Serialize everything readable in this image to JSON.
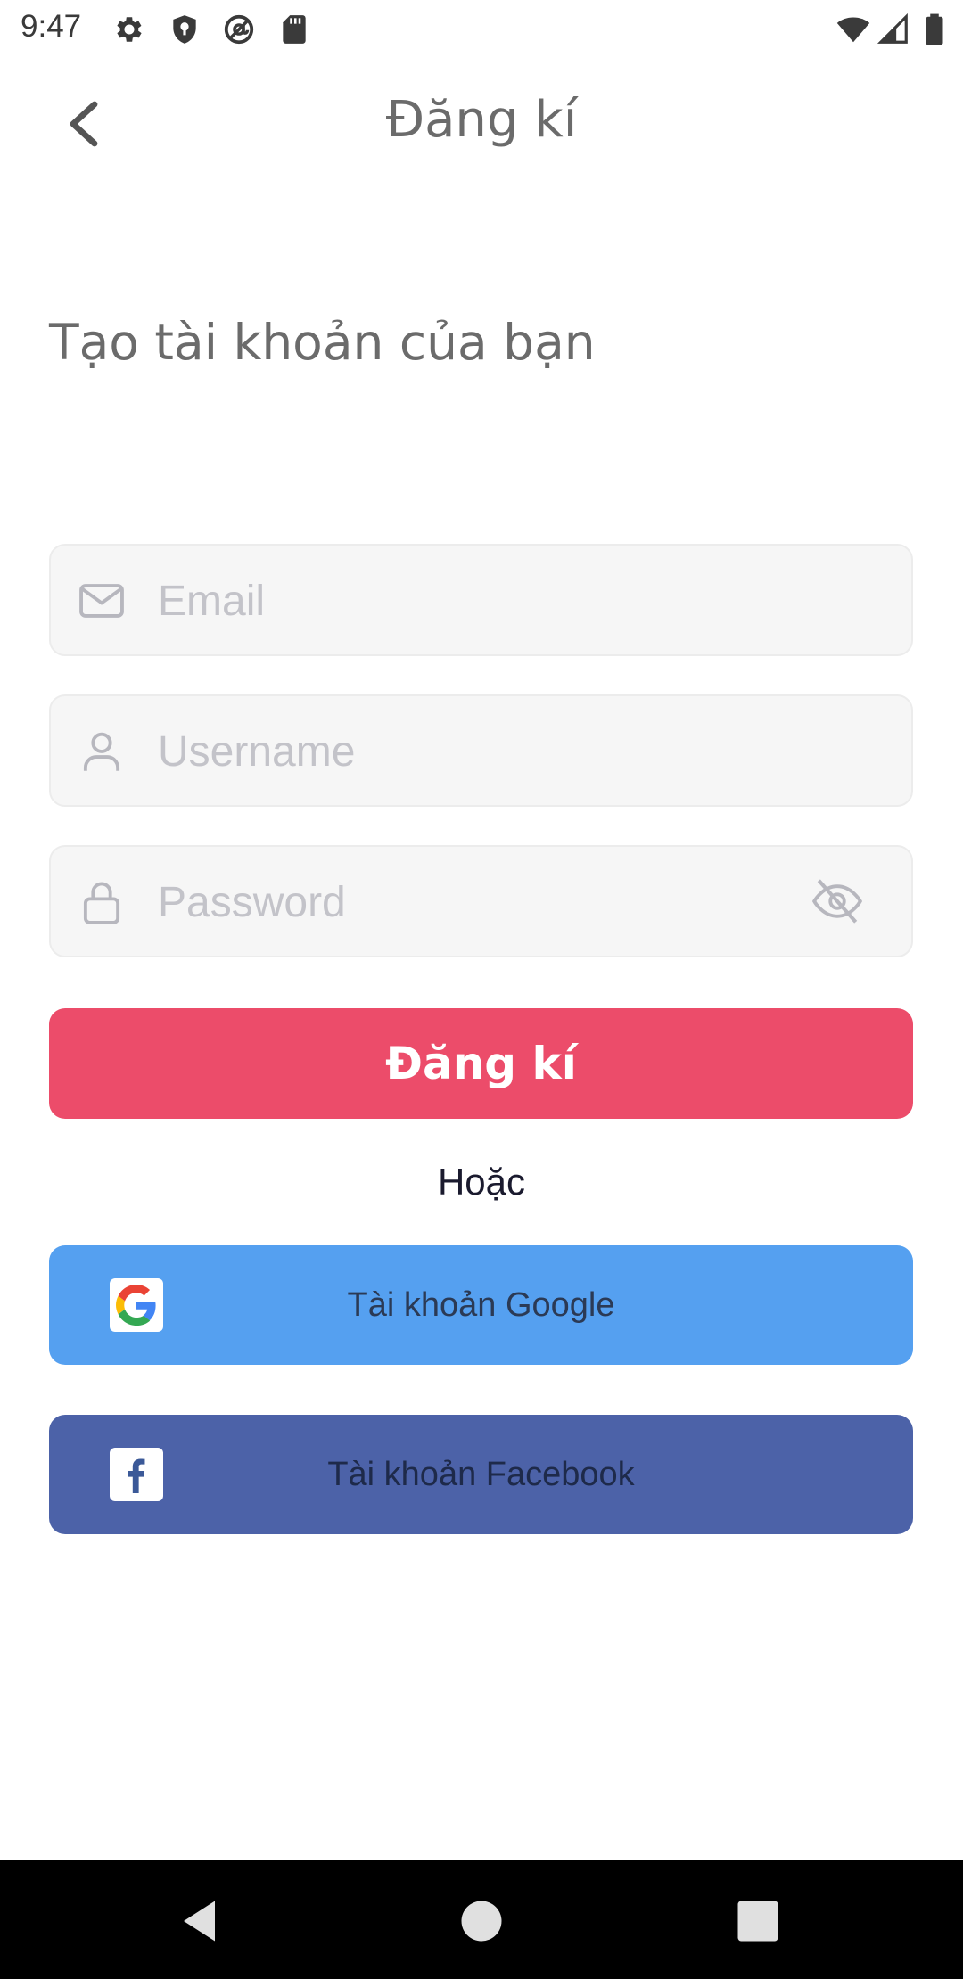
{
  "status_bar": {
    "time": "9:47"
  },
  "header": {
    "title": "Đăng kí"
  },
  "subtitle": "Tạo tài khoản của bạn",
  "form": {
    "email_placeholder": "Email",
    "username_placeholder": "Username",
    "password_placeholder": "Password",
    "submit_label": "Đăng kí"
  },
  "divider_text": "Hoặc",
  "social": {
    "google_label": "Tài khoản Google",
    "facebook_label": "Tài khoản Facebook"
  },
  "colors": {
    "accent": "#ec4c6a",
    "google": "#55a0f0",
    "facebook": "#4c62a8",
    "field_bg": "#f6f6f6"
  },
  "icons": {
    "status": [
      "gear-icon",
      "shield-icon",
      "at-icon",
      "sd-card-icon",
      "wifi-icon",
      "signal-icon",
      "battery-icon"
    ],
    "fields": [
      "mail-icon",
      "user-icon",
      "lock-icon",
      "eye-off-icon"
    ],
    "nav": [
      "nav-back-icon",
      "nav-home-icon",
      "nav-recents-icon"
    ]
  }
}
